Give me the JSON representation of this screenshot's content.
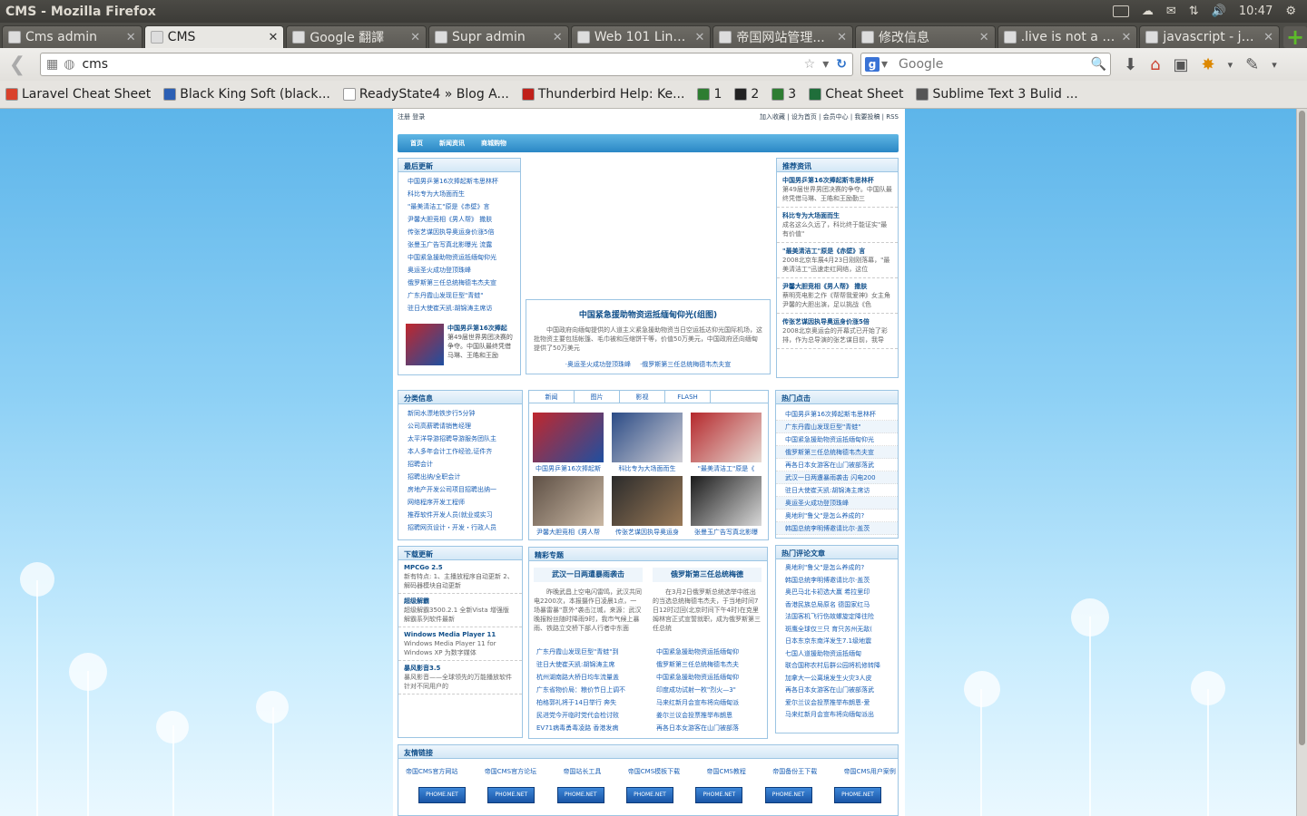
{
  "window": {
    "title": "CMS - Mozilla Firefox",
    "clock": "10:47"
  },
  "tabs": [
    {
      "label": "Cms admin",
      "active": false
    },
    {
      "label": "CMS",
      "active": true
    },
    {
      "label": "Google 翻譯",
      "active": false
    },
    {
      "label": "Supr admin",
      "active": false
    },
    {
      "label": "Web 101 Link...",
      "active": false
    },
    {
      "label": "帝国网站管理...",
      "active": false
    },
    {
      "label": "修改信息",
      "active": false
    },
    {
      "label": ".live is not a f...",
      "active": false
    },
    {
      "label": "javascript - jQ...",
      "active": false
    }
  ],
  "address": {
    "url": "cms",
    "search_placeholder": "Google"
  },
  "bookmarks": [
    {
      "label": "Laravel Cheat Sheet",
      "color": "#d9412b"
    },
    {
      "label": "Black King Soft (black...",
      "color": "#2b5fb4"
    },
    {
      "label": "ReadyState4 » Blog A...",
      "color": "#ffffff"
    },
    {
      "label": "Thunderbird Help: Ke...",
      "color": "#c0201a"
    },
    {
      "label": "1",
      "color": "#2e7d32"
    },
    {
      "label": "2",
      "color": "#222222"
    },
    {
      "label": "3",
      "color": "#2e7d32"
    },
    {
      "label": "Cheat Sheet",
      "color": "#1f6e3a"
    },
    {
      "label": "Sublime Text 3 Bulid ...",
      "color": "#555555"
    }
  ],
  "site": {
    "top_left": "注册 登录",
    "top_right": "加入收藏 | 设为首页 | 会员中心 | 我要投稿 | RSS",
    "nav": [
      "首页",
      "新闻资讯",
      "商城购物"
    ],
    "latest": {
      "title": "最后更新",
      "items": [
        "中国男乒第16次捧起斯韦思林杯",
        "科比专为大场面而生",
        "\"最美清洁工\"原是《赤壁》言",
        "尹馨大胆竞相《男人帮》 撒肤",
        "传张艺谋因执导奥运身价涨5倍",
        "张曼玉广告写真北影曝光 流露",
        "中国紧急援助物资运抵缅甸仰光",
        "奥运圣火成功登顶珠峰",
        "俄罗斯第三任总统梅德韦杰夫宣",
        "广东丹霞山发现巨型\"青蛙\"",
        "驻日大使崔天凯:胡锦涛主席访"
      ],
      "feature_title": "中国男乒第16次捧起",
      "feature_text": "第49届世界男团决赛的争夺。中国队最终凭借马琳、王皓和王励"
    },
    "headline": {
      "title": "中国紧急援助物资运抵缅甸仰光(组图)",
      "text": "中国政府向缅甸提供的人道主义紧急援助物资当日空运抵达仰光国际机场，这批物资主要包括帐篷、毛巾被和压缩饼干等，价值50万美元，中国政府还向缅甸提供了50万美元",
      "links": [
        "·奥运圣火成功登顶珠峰",
        "·俄罗斯第三任总统梅德韦杰夫宣"
      ]
    },
    "recommend": {
      "title": "推荐资讯",
      "items": [
        {
          "t": "中国男乒第16次捧起斯韦思林杯",
          "d": "第49届世界男团决赛的争夺。中国队最终凭借马琳、王皓和王励勤三"
        },
        {
          "t": "科比专为大场面而生",
          "d": "成名这么久远了，科比终于能证实\"最有价值\""
        },
        {
          "t": "\"最美清洁工\"原是《赤壁》言",
          "d": "2008北京车展4月23日刚刚落幕，\"最美清洁工\"迅速走红网络，这位"
        },
        {
          "t": "尹馨大胆竞相《男人帮》 撒肤",
          "d": "蔡明亮电影之作《帮帮我爱神》女主角尹馨的大胆出演，足以挑战《色"
        },
        {
          "t": "传张艺谋因执导奥运身价涨5倍",
          "d": "2008北京奥运会的开幕式已开始了彩排，作为总导演的张艺谋目前，我导"
        }
      ]
    },
    "category": {
      "title": "分类信息",
      "items": [
        "新同水漂地铁步行5分钟",
        "公司高薪聘请销售经理",
        "太平洋导游招聘导游服务团队主",
        "本人多年会计工作经验,证件齐",
        "招聘会计",
        "招聘出纳/全职会计",
        "房地产开发公司项目招聘出纳一",
        "网络程序开发工程师",
        "推荐软件开发人员(就业或实习",
        "招聘网页设计・开发・行政人员"
      ]
    },
    "photo_tabs": [
      "新闻",
      "图片",
      "影视",
      "FLASH"
    ],
    "photos": [
      {
        "cap": "中国男乒第16次捧起斯",
        "c1": "#c0272d",
        "c2": "#1f4fa0"
      },
      {
        "cap": "科比专为大场面而生",
        "c1": "#2b4b86",
        "c2": "#d0cfd5"
      },
      {
        "cap": "\"最美清洁工\"原是《",
        "c1": "#b5282c",
        "c2": "#e7dbd4"
      },
      {
        "cap": "尹馨大胆竞相《男人帮",
        "c1": "#5e5045",
        "c2": "#cab8a4"
      },
      {
        "cap": "传张艺谋因执导奥运身",
        "c1": "#2b2b2b",
        "c2": "#9a7a58"
      },
      {
        "cap": "张曼玉广告写真北影曝",
        "c1": "#1b1b1b",
        "c2": "#d8d8d8"
      }
    ],
    "hot": {
      "title": "热门点击",
      "items": [
        "中国男乒第16次捧起斯韦思林杯",
        "广东丹霞山发现巨型\"青蛙\"",
        "中国紧急援助物资运抵缅甸仰光",
        "俄罗斯第三任总统梅德韦杰夫宣",
        "再各日本女游客在山门被部落武",
        "武汉一日两遭暴雨袭击 闪电200",
        "驻日大使崔天凯:胡锦涛主席访",
        "奥运圣火成功登顶珠峰",
        "奥地利\"鲁父\"是怎么养成的?",
        "韩国总统李明博邀请比尔·盖茨"
      ]
    },
    "download": {
      "title": "下载更新",
      "items": [
        {
          "t": "MPCGo 2.5",
          "d": "新有特点: 1、主播放程序自动更新 2、解码器模块自动更新"
        },
        {
          "t": "超级解霸",
          "d": "超级解霸3500.2.1 全新Vista 增强版 解霸系列软件最新"
        },
        {
          "t": "Windows Media Player 11",
          "d": "Windows Media Player 11 for Windows XP 为数字媒体"
        },
        {
          "t": "暴风影音3.5",
          "d": "暴风影音——全球领先的万能播放软件 针对不同用户的"
        }
      ]
    },
    "topics": {
      "title": "精彩专题",
      "a": {
        "h": "武汉一日两遭暴雨袭击",
        "p": "昨晚武昌上空电闪雷鸣，武汉共同电2200次，本报摄作日凌晨1点，一场暴雷暴\"意外\"袭击江城，来源：武汉晚报粉丝随时降雨9时，我市气候上暴雨、铁路立交桥下部人行者中东面"
      },
      "b": {
        "h": "俄罗斯第三任总统梅德",
        "p": "在3月2日俄罗斯总统选举中胜出的当选总统梅德韦杰夫，于当地时间7日12时过回(北京时间下午4时)在克里姆林宫正式宣誓就职，成为俄罗斯第三任总统"
      },
      "left": [
        "广东丹霞山发现巨型\"青蛙\"到",
        "驻日大使崔天凯:胡锦涛主席",
        "杭州湖南路大桥日均车流量盖",
        "广东省物价局：粮价节日上调不",
        "柏格郭礼将于14日举行 奔失",
        "民进党今开临时党代会检讨败",
        "EV71病毒勇毒凌路 香港发病"
      ],
      "right": [
        "中国紧急援助物资运抵缅甸仰",
        "俄罗斯第三任总统梅德韦杰夫",
        "中国紧急援助物资运抵缅甸仰",
        "印度成功试射一枚\"烈火—3\"",
        "马来红新月会宣布将向缅甸派",
        "姜尔兰议会投票推举布朗恩",
        "再各日本女游客在山门被部落"
      ]
    },
    "comments": {
      "title": "热门评论文章",
      "items": [
        "奥地利\"鲁父\"是怎么养成的?",
        "韩国总统李明博邀请比尔·盖茨",
        "奥巴马北卡初选大赢 希拉里印",
        "香港民族总局原名 德国家红马",
        "法国客机飞行伤故螺旋定降往险",
        "斑鹰全球仅三只 育只苏州无敌(",
        "日本东京东南洋发生7.1级地震",
        "七国人道援助物资运抵缅甸",
        "联合国称农村后群公园将机修转降",
        "加拿大一公离境发生火灾3人皮",
        "再各日本女游客在山门被部落武",
        "爱尔兰议会投票推举布朗恩-爱",
        "马来红新月会宣布将向缅甸派出"
      ]
    },
    "friends": {
      "title": "友情链接",
      "links": [
        "帝国CMS官方网站",
        "帝国CMS官方论坛",
        "帝国站长工具",
        "帝国CMS模板下载",
        "帝国CMS教程",
        "帝国备份王下载",
        "帝国CMS用户案例"
      ],
      "badge": "PHOME.NET"
    }
  }
}
